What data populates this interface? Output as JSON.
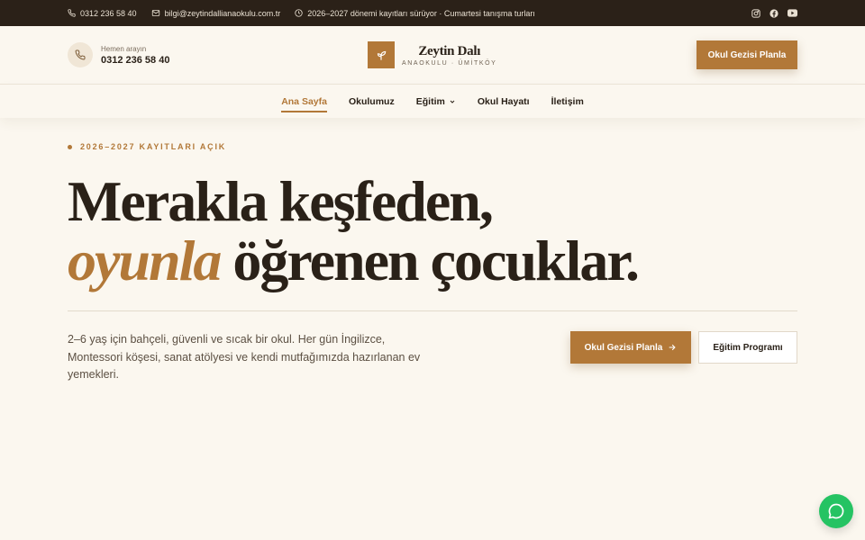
{
  "topbar": {
    "phone": "0312 236 58 40",
    "email": "bilgi@zeytindallianaokulu.com.tr",
    "notice": "2026–2027 dönemi kayıtları sürüyor · Cumartesi tanışma turları",
    "socials": [
      "instagram-icon",
      "facebook-icon",
      "youtube-icon"
    ]
  },
  "header": {
    "call_label": "Hemen arayın",
    "call_number": "0312 236 58 40",
    "logo_name": "Zeytin Dalı",
    "logo_sub": "ANAOKULU · ÜMİTKÖY",
    "cta": "Okul Gezisi Planla"
  },
  "nav": {
    "items": [
      {
        "label": "Ana Sayfa",
        "active": true
      },
      {
        "label": "Okulumuz"
      },
      {
        "label": "Eğitim",
        "dropdown": true
      },
      {
        "label": "Okul Hayatı"
      },
      {
        "label": "İletişim"
      }
    ]
  },
  "hero": {
    "eyebrow": "2026–2027 KAYITLARI AÇIK",
    "line1": "Merakla keşfeden,",
    "line2_accent": "oyunla",
    "line2_rest": " öğrenen çocuklar.",
    "description": "2–6 yaş için bahçeli, güvenli ve sıcak bir okul. Her gün İngilizce, Montessori köşesi, sanat atölyesi ve kendi mutfağımızda hazırlanan ev yemekleri.",
    "cta_primary": "Okul Gezisi Planla",
    "cta_secondary": "Eğitim Programı"
  },
  "colors": {
    "accent": "#b27838",
    "topbar": "#2b2118",
    "background": "#fbf7ef",
    "whatsapp": "#25c363"
  }
}
